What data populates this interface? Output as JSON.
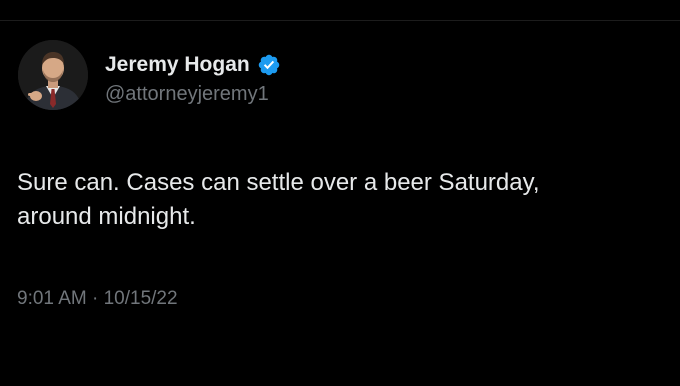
{
  "tweet": {
    "author": {
      "display_name": "Jeremy Hogan",
      "handle": "@attorneyjeremy1",
      "verified": true,
      "verified_icon": "verified-badge-icon",
      "verified_color": "#1d9bf0"
    },
    "text_lines": [
      "Sure can. Cases can settle over a beer Saturday,",
      "around midnight."
    ],
    "timestamp": "9:01 AM · 10/15/22"
  },
  "colors": {
    "background": "#000000",
    "primary_text": "#e7e9ea",
    "secondary_text": "#71767b"
  }
}
